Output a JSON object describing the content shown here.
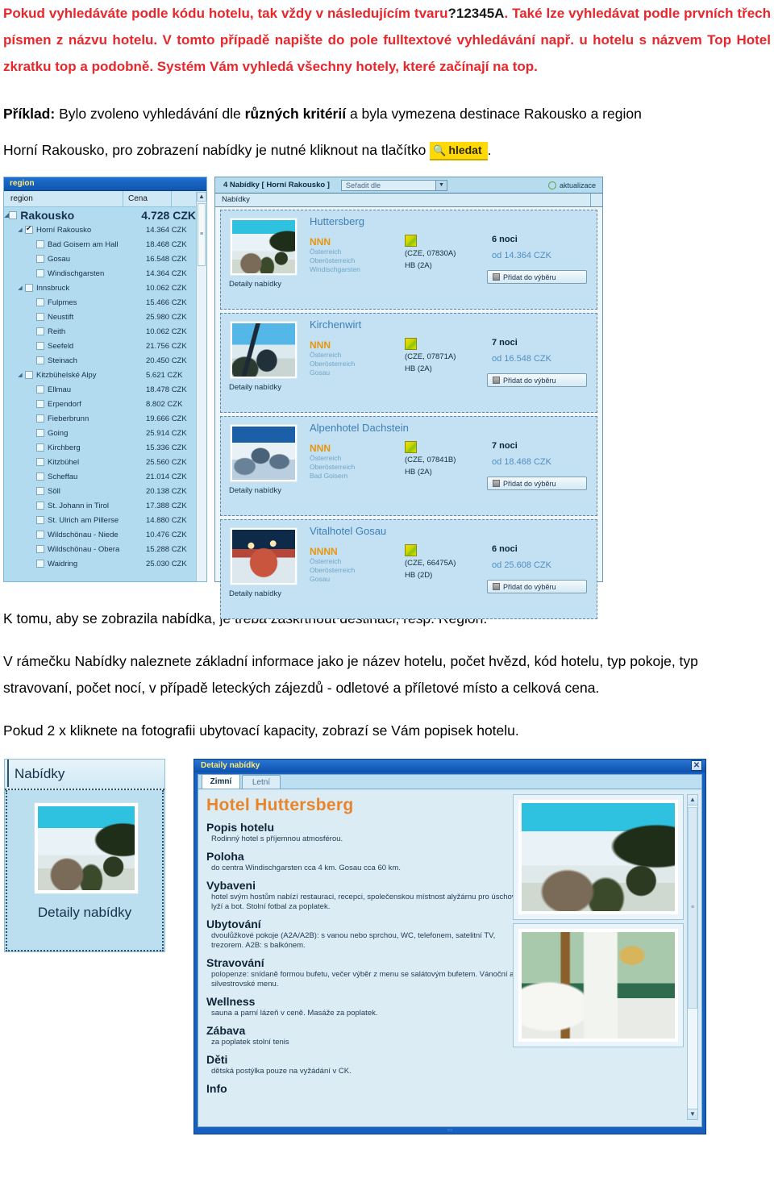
{
  "doc": {
    "intro_red_html_parts": {
      "p1_a": "Pokud vyhledáváte podle kódu hotelu, tak vždy v následujícím tvaru",
      "p1_code": "?12345A",
      "p1_b": ". Také lze vyhledávat podle prvních třech písmen z názvu hotelu. V tomto případě napište do pole fulltextové vyhledávání např. u hotelu s názvem Top Hotel zkratku top a podobně. Systém Vám vyhledá všechny hotely, které začínají na top."
    },
    "example_label": "Příklad:",
    "example_text_1": " Bylo zvoleno vyhledávání dle ",
    "example_bold": "různých kritérií",
    "example_text_2": " a byla vymezena destinace Rakousko a region",
    "example_line2_a": "Horní Rakousko, pro zobrazení nabídky je nutné kliknout na tlačítko",
    "search_button_label": "hledat",
    "search_button_icon": "magnifier-icon",
    "example_line2_b": ".",
    "para_after_shot1": "K tomu, aby se zobrazila nabídka, je třeba zaškrtnout destinaci, resp. Region.",
    "para_info": "V rámečku Nabídky naleznete základní informace jako je název hotelu, počet hvězd, kód hotelu, typ pokoje, typ stravovaní, počet nocí, v případě leteckých zájezdů - odletové a příletové místo a celková cena.",
    "para_dblclick": "Pokud 2 x kliknete na fotografii ubytovací kapacity, zobrazí se Vám popisek hotelu."
  },
  "colors": {
    "red_text": "#e8262b",
    "highlight_yellow": "#ffd900",
    "titlebar_blue": "#1763c6",
    "titlebar_text": "#ffe97a",
    "panel_blue": "#b3dbef",
    "star_orange": "#e8960f",
    "hotel_name_orange": "#e8852a",
    "link_blue": "#3d7fb8"
  },
  "shot1": {
    "region_panel": {
      "title": "region",
      "columns": [
        "region",
        "Cena"
      ],
      "scroll_up_icon": "chevron-up-icon",
      "rows": [
        {
          "level": 0,
          "name": "Rakousko",
          "price": "4.728 CZK",
          "checked": false,
          "expander": true
        },
        {
          "level": 1,
          "name": "Horní Rakousko",
          "price": "14.364 CZK",
          "checked": true,
          "expander": true
        },
        {
          "level": 2,
          "name": "Bad Goisern am Hall",
          "price": "18.468 CZK",
          "checked": false,
          "expander": false
        },
        {
          "level": 2,
          "name": "Gosau",
          "price": "16.548 CZK",
          "checked": false,
          "expander": false
        },
        {
          "level": 2,
          "name": "Windischgarsten",
          "price": "14.364 CZK",
          "checked": false,
          "expander": false
        },
        {
          "level": 1,
          "name": "Innsbruck",
          "price": "10.062 CZK",
          "checked": false,
          "expander": true
        },
        {
          "level": 2,
          "name": "Fulpmes",
          "price": "15.466 CZK",
          "checked": false,
          "expander": false
        },
        {
          "level": 2,
          "name": "Neustift",
          "price": "25.980 CZK",
          "checked": false,
          "expander": false
        },
        {
          "level": 2,
          "name": "Reith",
          "price": "10.062 CZK",
          "checked": false,
          "expander": false
        },
        {
          "level": 2,
          "name": "Seefeld",
          "price": "21.756 CZK",
          "checked": false,
          "expander": false
        },
        {
          "level": 2,
          "name": "Steinach",
          "price": "20.450 CZK",
          "checked": false,
          "expander": false
        },
        {
          "level": 1,
          "name": "Kitzbühelské Alpy",
          "price": "5.621 CZK",
          "checked": false,
          "expander": true
        },
        {
          "level": 2,
          "name": "Ellmau",
          "price": "18.478 CZK",
          "checked": false,
          "expander": false
        },
        {
          "level": 2,
          "name": "Erpendorf",
          "price": "8.802 CZK",
          "checked": false,
          "expander": false
        },
        {
          "level": 2,
          "name": "Fieberbrunn",
          "price": "19.666 CZK",
          "checked": false,
          "expander": false
        },
        {
          "level": 2,
          "name": "Going",
          "price": "25.914 CZK",
          "checked": false,
          "expander": false
        },
        {
          "level": 2,
          "name": "Kirchberg",
          "price": "15.336 CZK",
          "checked": false,
          "expander": false
        },
        {
          "level": 2,
          "name": "Kitzbühel",
          "price": "25.560 CZK",
          "checked": false,
          "expander": false
        },
        {
          "level": 2,
          "name": "Scheffau",
          "price": "21.014 CZK",
          "checked": false,
          "expander": false
        },
        {
          "level": 2,
          "name": "Söll",
          "price": "20.138 CZK",
          "checked": false,
          "expander": false
        },
        {
          "level": 2,
          "name": "St. Johann in Tirol",
          "price": "17.388 CZK",
          "checked": false,
          "expander": false
        },
        {
          "level": 2,
          "name": "St. Ulrich am Pillerse",
          "price": "14.880 CZK",
          "checked": false,
          "expander": false
        },
        {
          "level": 2,
          "name": "Wildschönau - Niede",
          "price": "10.476 CZK",
          "checked": false,
          "expander": false
        },
        {
          "level": 2,
          "name": "Wildschönau - Obera",
          "price": "15.288 CZK",
          "checked": false,
          "expander": false
        },
        {
          "level": 2,
          "name": "Waidring",
          "price": "25.030 CZK",
          "checked": false,
          "expander": false
        }
      ]
    },
    "offers_panel": {
      "count_label": "4 Nabídky [ Horní Rakousko ]",
      "sort_placeholder": "Seřadit dle",
      "sort_arrow_icon": "chevron-down-icon",
      "refresh_label": "aktualizace",
      "refresh_icon": "refresh-icon",
      "subbar_label": "Nabídky",
      "detail_link_label": "Detaily nabídky",
      "add_button_label": "Přidat do výběru",
      "add_button_icon": "cart-icon",
      "offers": [
        {
          "name": "Huttersberg",
          "stars": "NNN",
          "country": "Österreich",
          "region": "Oberösterreich",
          "place": "Windischgarsten",
          "code": "(CZE, 07830A)",
          "board": "HB (2A)",
          "nights": "6 noci",
          "price": "od 14.364 CZK",
          "pic": "pic-mtn"
        },
        {
          "name": "Kirchenwirt",
          "stars": "NNN",
          "country": "Österreich",
          "region": "Oberösterreich",
          "place": "Gosau",
          "code": "(CZE, 07871A)",
          "board": "HB (2A)",
          "nights": "7 noci",
          "price": "od 16.548 CZK",
          "pic": "pic-church"
        },
        {
          "name": "Alpenhotel Dachstein",
          "stars": "NNN",
          "country": "Österreich",
          "region": "Oberösterreich",
          "place": "Bad Goisern",
          "code": "(CZE, 07841B)",
          "board": "HB (2A)",
          "nights": "7 noci",
          "price": "od 18.468 CZK",
          "pic": "pic-alpen"
        },
        {
          "name": "Vitalhotel Gosau",
          "stars": "NNNN",
          "country": "Österreich",
          "region": "Oberösterreich",
          "place": "Gosau",
          "code": "(CZE, 66475A)",
          "board": "HB (2D)",
          "nights": "6 noci",
          "price": "od 25.608 CZK",
          "pic": "pic-vital"
        }
      ]
    }
  },
  "shot2": {
    "nabidky_panel": {
      "header": "Nabídky",
      "caption": "Detaily nabídky"
    },
    "dialog": {
      "title": "Detaily nabídky",
      "close_icon": "close-icon",
      "tabs": [
        {
          "label": "Zimní",
          "active": true
        },
        {
          "label": "Letní",
          "active": false
        }
      ],
      "hotel_name": "Hotel Huttersberg",
      "sections": [
        {
          "heading": "Popis hotelu",
          "body": "Rodinný hotel s příjemnou atmosférou."
        },
        {
          "heading": "Poloha",
          "body": "do centra Windischgarsten cca 4 km. Gosau cca 60 km."
        },
        {
          "heading": "Vybaveni",
          "body": "hotel svým hostům nabízí restauraci, recepci, společenskou místnost alyžárnu pro úschovu lyží a bot. Stolní fotbal za poplatek."
        },
        {
          "heading": "Ubytování",
          "body": "dvoulůžkové pokoje (A2A/A2B): s vanou nebo sprchou, WC, telefonem, satelitní TV, trezorem. A2B: s balkónem."
        },
        {
          "heading": "Stravování",
          "body": "polopenze: snídaně formou bufetu, večer výběr z menu se salátovým bufetem. Vánoční a silvestrovské menu."
        },
        {
          "heading": "Wellness",
          "body": "sauna a parní lázeň v ceně. Masáže za poplatek."
        },
        {
          "heading": "Zábava",
          "body": "za poplatek stolní tenis"
        },
        {
          "heading": "Děti",
          "body": "dětská postýlka pouze na vyžádání v CK."
        },
        {
          "heading": "Info",
          "body": ""
        }
      ],
      "scroll_up_icon": "chevron-up-icon",
      "scroll_down_icon": "chevron-down-icon"
    }
  }
}
